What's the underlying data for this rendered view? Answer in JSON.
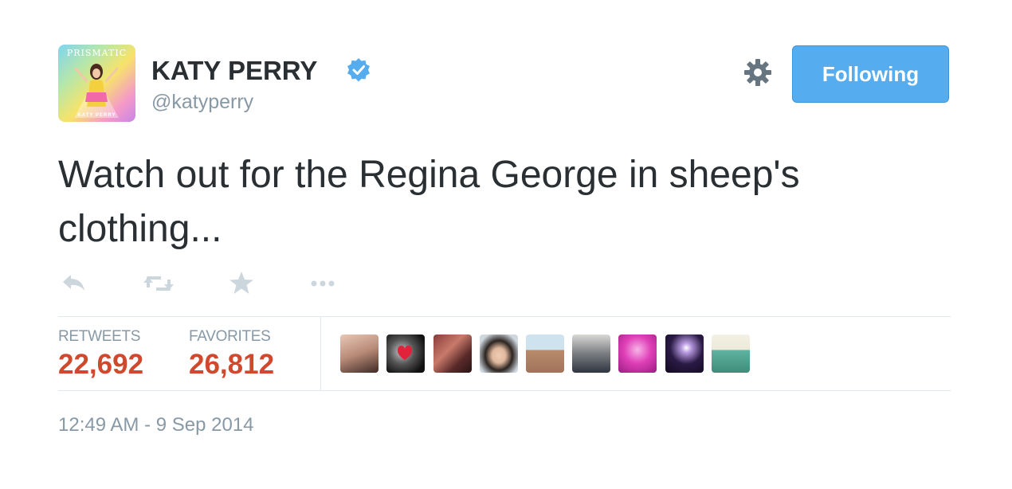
{
  "profile": {
    "name": "KATY PERRY",
    "handle": "@katyperry",
    "avatar_art_title": "PRISMATIC",
    "avatar_art_name": "KATY PERRY",
    "verified": true
  },
  "header": {
    "follow_button_label": "Following",
    "settings_icon": "gear-icon"
  },
  "tweet": {
    "text": "Watch out for the Regina George in sheep's clothing..."
  },
  "actions": [
    {
      "name": "reply-icon"
    },
    {
      "name": "retweet-icon"
    },
    {
      "name": "favorite-icon"
    },
    {
      "name": "more-icon"
    }
  ],
  "stats": {
    "retweets_label": "RETWEETS",
    "retweets_value": "22,692",
    "favorites_label": "FAVORITES",
    "favorites_value": "26,812"
  },
  "timestamp": "12:49 AM - 9 Sep 2014",
  "colors": {
    "accent": "#55acee",
    "stat_value": "#d0492d",
    "muted": "#8899a6",
    "text": "#292f33",
    "divider": "#e1e8ed"
  },
  "favorite_users": [
    {
      "name": "fav-user-avatar"
    },
    {
      "name": "fav-user-avatar"
    },
    {
      "name": "fav-user-avatar"
    },
    {
      "name": "fav-user-avatar"
    },
    {
      "name": "fav-user-avatar"
    },
    {
      "name": "fav-user-avatar"
    },
    {
      "name": "fav-user-avatar"
    },
    {
      "name": "fav-user-avatar"
    },
    {
      "name": "fav-user-avatar"
    }
  ]
}
